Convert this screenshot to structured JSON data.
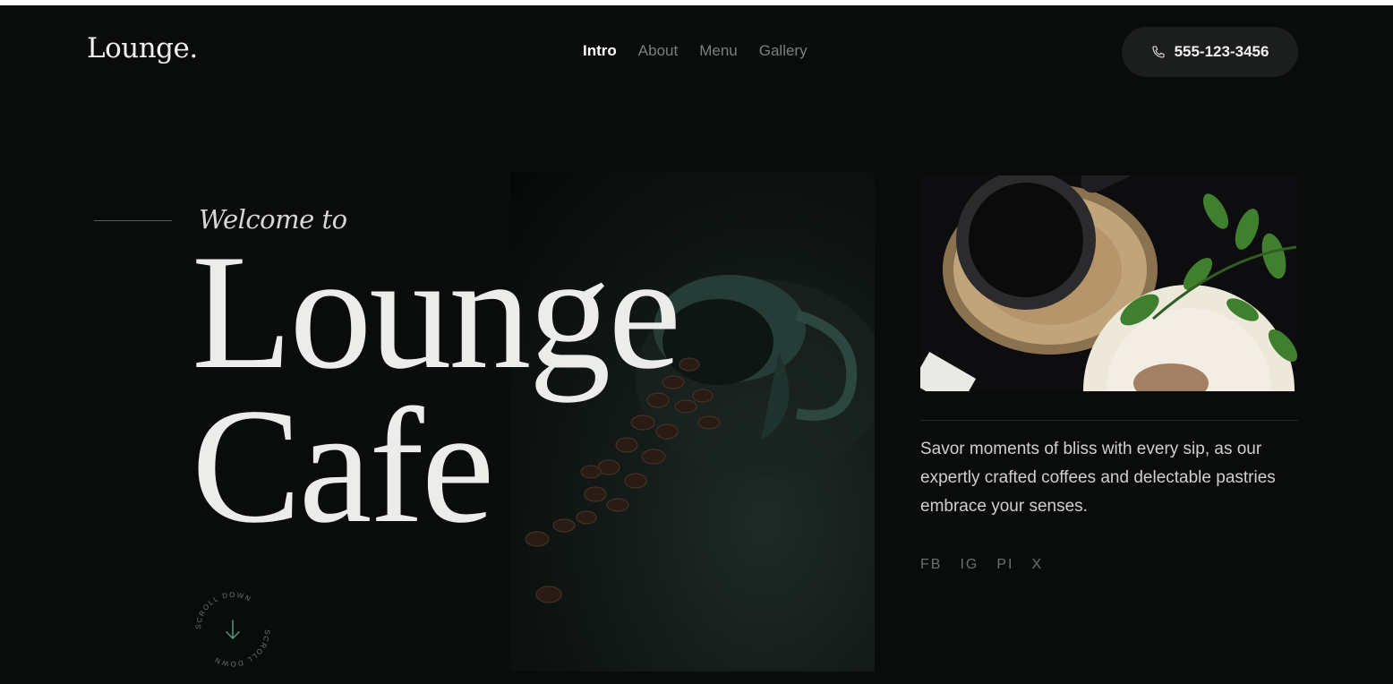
{
  "brand": {
    "logo": "Lounge."
  },
  "nav": {
    "items": [
      {
        "label": "Intro",
        "active": true
      },
      {
        "label": "About",
        "active": false
      },
      {
        "label": "Menu",
        "active": false
      },
      {
        "label": "Gallery",
        "active": false
      }
    ]
  },
  "contact": {
    "phone": "555-123-3456",
    "icon": "phone-icon"
  },
  "hero": {
    "welcome": "Welcome to",
    "title_line1": "Lounge",
    "title_line2": "Cafe",
    "scroll_label": "SCROLL DOWN",
    "scroll_icon": "arrow-down-icon"
  },
  "side": {
    "description": "Savor moments of bliss with every sip, as our expertly crafted coffees and delectable pastries embrace your senses."
  },
  "socials": [
    "FB",
    "IG",
    "PI",
    "X"
  ],
  "colors": {
    "background": "#0a0c0b",
    "text": "#e6e6e4",
    "muted": "#7c7f7d",
    "accent_green": "#4f9a7a",
    "pill_bg": "#1c1e1d"
  }
}
